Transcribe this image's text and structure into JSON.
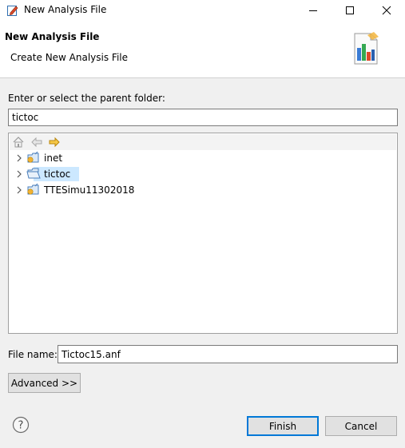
{
  "window": {
    "title": "New Analysis File",
    "icon": "edit-file-icon",
    "controls": [
      "minimize",
      "maximize",
      "close"
    ]
  },
  "banner": {
    "heading": "New Analysis File",
    "description": "Create New Analysis File",
    "image": "analysis-wizard-icon"
  },
  "parent_folder": {
    "label": "Enter or select the parent folder:",
    "value": "tictoc"
  },
  "tree": {
    "nav_icons": [
      "home-icon",
      "back-arrow-icon",
      "forward-arrow-icon"
    ],
    "items": [
      {
        "label": "inet",
        "selected": false
      },
      {
        "label": "tictoc",
        "selected": true
      },
      {
        "label": "TTESimu11302018",
        "selected": false
      }
    ]
  },
  "file_name": {
    "label": "File name:",
    "value": "Tictoc15.anf"
  },
  "buttons": {
    "advanced": "Advanced >>",
    "finish": "Finish",
    "cancel": "Cancel"
  },
  "colors": {
    "selection": "#cce8ff",
    "default_button_border": "#0078d7",
    "background": "#f0f0f0"
  }
}
